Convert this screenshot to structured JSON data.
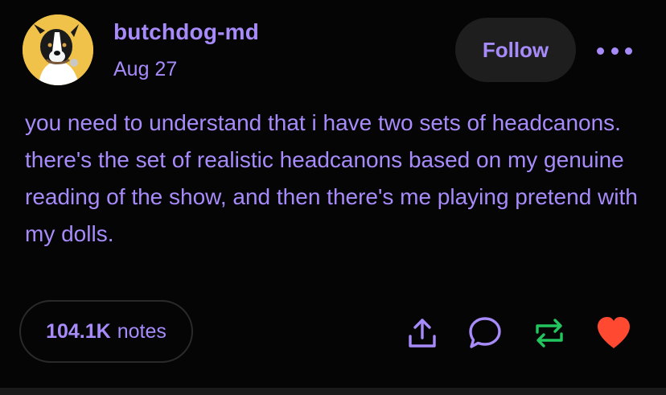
{
  "post": {
    "username": "butchdog-md",
    "date": "Aug 27",
    "follow_label": "Follow",
    "more_icon": "ellipsis-icon",
    "body": "you need to understand that i have two sets of headcanons. there's the set of realistic headcanons based on my genuine reading of the show, and then there's me playing pretend with my dolls.",
    "notes_count": "104.1K",
    "notes_label": "notes"
  },
  "actions": {
    "share_icon": "share-icon",
    "reply_icon": "reply-icon",
    "reblog_icon": "reblog-icon",
    "like_icon": "heart-icon"
  },
  "colors": {
    "background": "#000000",
    "accent_text": "#a78bfa",
    "button_bg": "#1e1e1e",
    "reblog": "#22c55e",
    "like": "#ff4930"
  }
}
